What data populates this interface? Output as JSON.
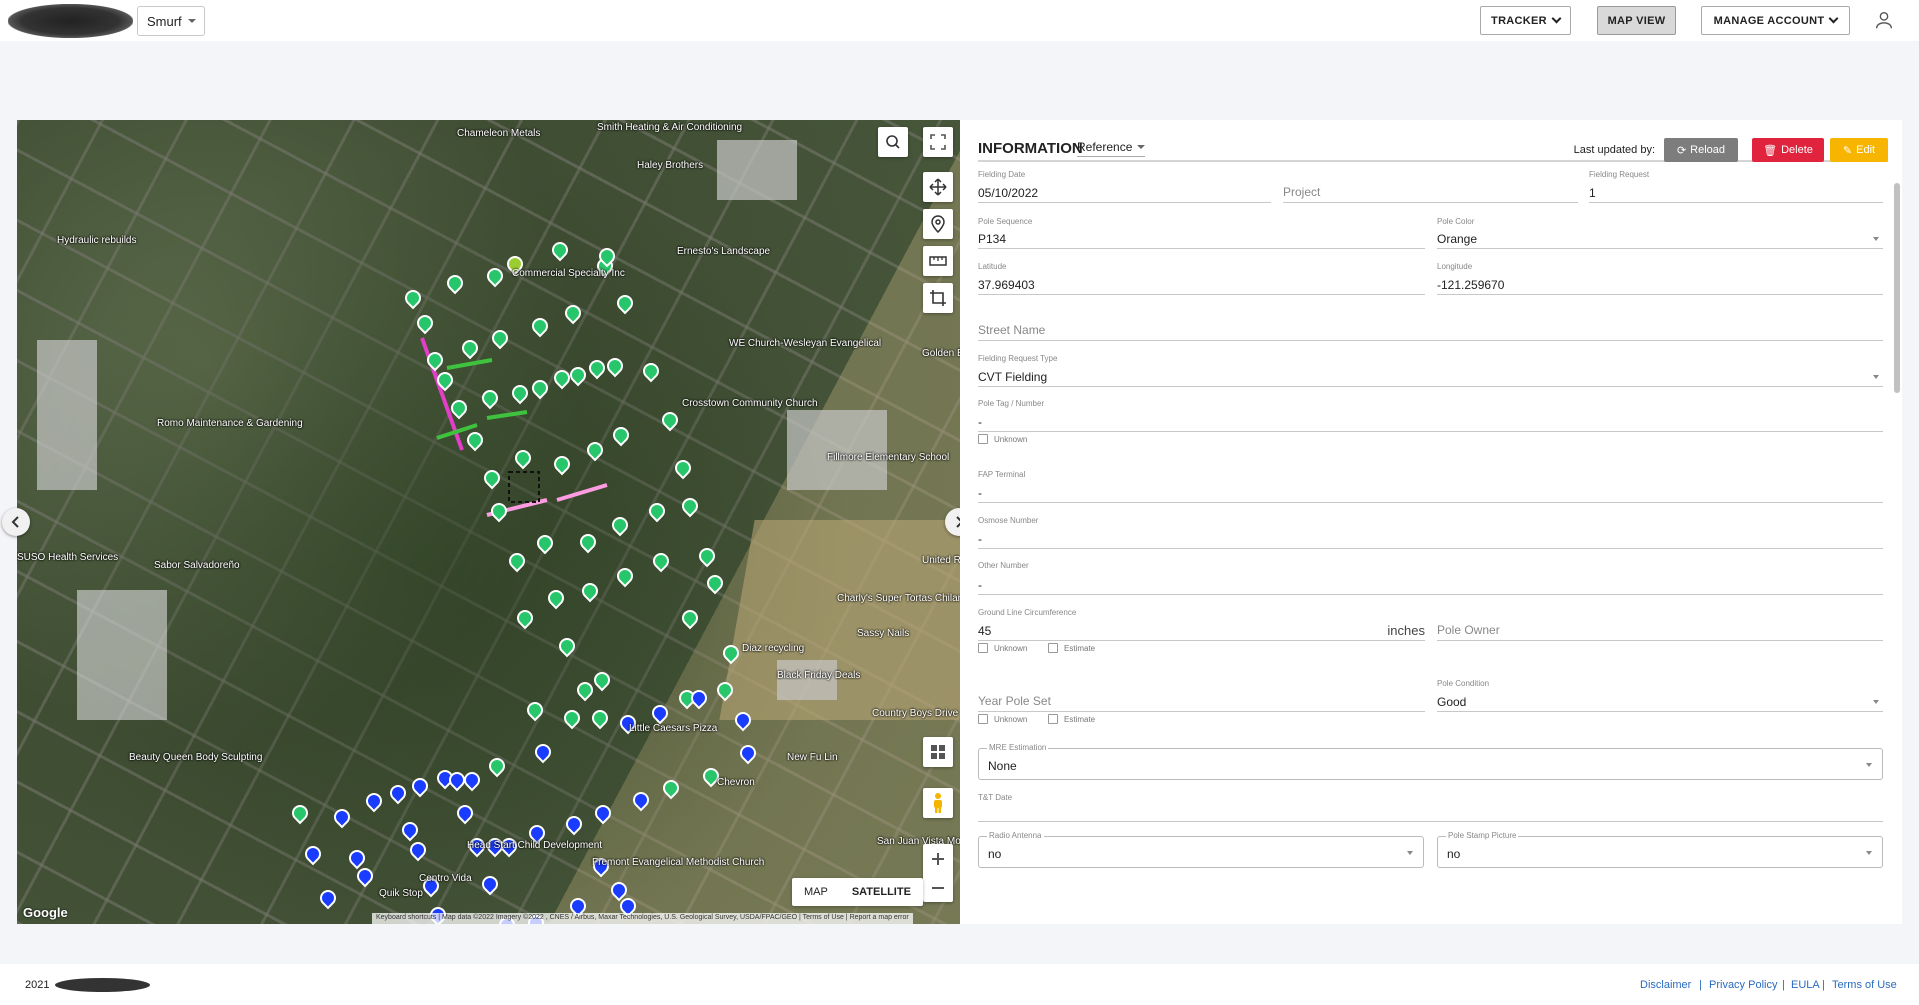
{
  "header": {
    "org_select": "Smurf",
    "tracker_label": "TRACKER",
    "map_view_label": "MAP VIEW",
    "manage_account_label": "MANAGE ACCOUNT"
  },
  "map": {
    "type_map": "MAP",
    "type_satellite": "SATELLITE",
    "google": "Google",
    "attribution": "Keyboard shortcuts | Map data ©2022 Imagery ©2022 , CNES / Airbus, Maxar Technologies, U.S. Geological Survey, USDA/FPAC/GEO | Terms of Use | Report a map error",
    "labels": {
      "chameleon": "Chameleon Metals",
      "smith": "Smith Heating & Air Conditioning",
      "haley": "Haley Brothers",
      "hydraulic": "Hydraulic rebuilds",
      "commercial": "Commercial Specialty Inc",
      "ernesto": "Ernesto's Landscape",
      "we_church": "WE Church-Wesleyan Evangelical",
      "crosstown": "Crosstown Community Church",
      "romo": "Romo Maintenance & Gardening",
      "fillmore": "Fillmore Elementary School",
      "suso": "SUSO Health Services",
      "sabor": "Sabor Salvadoreño",
      "charlys": "Charly's Super Tortas Chilangas",
      "sassy": "Sassy Nails",
      "diaz": "Diaz recycling",
      "black_friday": "Black Friday Deals",
      "country_boys": "Country Boys Drive (FROSTY N BURGER)",
      "little_caesars": "Little Caesars Pizza",
      "new_fu_lin": "New Fu Lin",
      "beauty_queen": "Beauty Queen Body Sculpting",
      "chevron": "Chevron",
      "head_start": "Head Start Child Development",
      "fremont": "Fremont Evangelical Methodist Church",
      "san_juan": "San Juan Vista Mobile",
      "centro_vida": "Centro Vida",
      "quik_stop": "Quik Stop",
      "united": "United R",
      "golden": "Golden Bo"
    }
  },
  "info": {
    "title": "INFORMATION",
    "reference": "Reference",
    "last_updated": "Last updated by:",
    "reload": "Reload",
    "delete": "Delete",
    "edit": "Edit",
    "fielding_date_label": "Fielding Date",
    "fielding_date": "05/10/2022",
    "project_placeholder": "Project",
    "fielding_request_label": "Fielding Request",
    "fielding_request": "1",
    "pole_sequence_label": "Pole Sequence",
    "pole_sequence": "P134",
    "pole_color_label": "Pole Color",
    "pole_color": "Orange",
    "latitude_label": "Latitude",
    "latitude": "37.969403",
    "longitude_label": "Longitude",
    "longitude": "-121.259670",
    "street_name_placeholder": "Street Name",
    "fielding_request_type_label": "Fielding Request Type",
    "fielding_request_type": "CVT Fielding",
    "pole_tag_label": "Pole Tag / Number",
    "pole_tag": "-",
    "unknown": "Unknown",
    "estimate": "Estimate",
    "fap_terminal_label": "FAP Terminal",
    "fap_terminal": "-",
    "osmose_label": "Osmose Number",
    "osmose": "-",
    "other_number_label": "Other Number",
    "other_number": "-",
    "glc_label": "Ground Line Circumference",
    "glc": "45",
    "glc_unit": "inches",
    "pole_owner_placeholder": "Pole Owner",
    "year_pole_set_placeholder": "Year Pole Set",
    "pole_condition_label": "Pole Condition",
    "pole_condition": "Good",
    "mre_label": "MRE Estimation",
    "mre": "None",
    "tt_date_label": "T&T Date",
    "radio_antenna_label": "Radio Antenna",
    "radio_antenna": "no",
    "pole_stamp_label": "Pole Stamp Picture",
    "pole_stamp": "no"
  },
  "footer": {
    "year": "2021",
    "disclaimer": "Disclaimer",
    "privacy": "Privacy Policy",
    "eula": "EULA",
    "terms": "Terms of Use",
    "sep": "|"
  }
}
